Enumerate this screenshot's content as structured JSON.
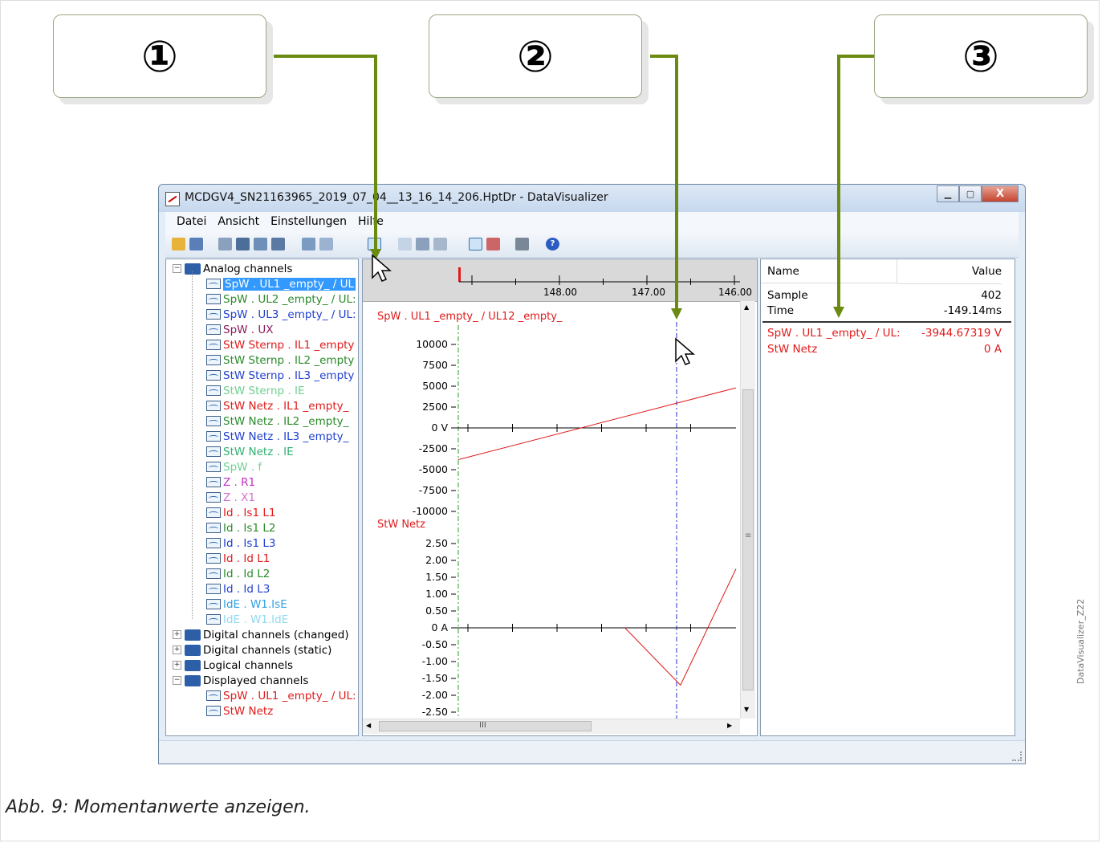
{
  "callouts": [
    {
      "label": "①"
    },
    {
      "label": "②"
    },
    {
      "label": "③"
    }
  ],
  "window": {
    "title": "MCDGV4_SN21163965_2019_07_04__13_16_14_206.HptDr - DataVisualizer",
    "minimize": "▁",
    "maximize": "▢",
    "close": "X"
  },
  "menu": [
    "Datei",
    "Ansicht",
    "Einstellungen",
    "Hilfe"
  ],
  "toolbar_icons": [
    "open-folder-icon",
    "save-icon",
    "settings-icon",
    "cursor-tool-icon",
    "table-icon",
    "window-icon",
    "channel-icon",
    "grid-icon",
    "momentary-values-icon",
    "zoom-1-1-icon",
    "zoom-in-icon",
    "zoom-out-icon",
    "fit-width-icon",
    "cursor-marker-icon",
    "print-icon",
    "help-icon"
  ],
  "tree": {
    "analog_folder": "Analog channels",
    "analog_items": [
      {
        "label": "SpW . UL1 _empty_ / UL",
        "color": "#ffffff",
        "selected": true
      },
      {
        "label": "SpW . UL2 _empty_ / UL:",
        "color": "#2a8a2a"
      },
      {
        "label": "SpW . UL3 _empty_ / UL:",
        "color": "#1f3fcf"
      },
      {
        "label": "SpW . UX",
        "color": "#8a1a5a"
      },
      {
        "label": "StW Sternp . IL1 _empty",
        "color": "#e01a1a"
      },
      {
        "label": "StW Sternp . IL2 _empty",
        "color": "#2a8a2a"
      },
      {
        "label": "StW Sternp . IL3 _empty",
        "color": "#1f3fcf"
      },
      {
        "label": "StW Sternp . IE",
        "color": "#6fd08f"
      },
      {
        "label": "StW Netz . IL1 _empty_",
        "color": "#e01a1a"
      },
      {
        "label": "StW Netz . IL2 _empty_",
        "color": "#2a8a2a"
      },
      {
        "label": "StW Netz . IL3 _empty_",
        "color": "#1f3fcf"
      },
      {
        "label": "StW Netz . IE",
        "color": "#2fb070"
      },
      {
        "label": "SpW . f",
        "color": "#6fd08f"
      },
      {
        "label": "Z . R1",
        "color": "#c030c0"
      },
      {
        "label": "Z . X1",
        "color": "#d070d0"
      },
      {
        "label": "Id . Is1 L1",
        "color": "#e01a1a"
      },
      {
        "label": "Id . Is1 L2",
        "color": "#2a8a2a"
      },
      {
        "label": "Id . Is1 L3",
        "color": "#1f3fcf"
      },
      {
        "label": "Id . Id L1",
        "color": "#e01a1a"
      },
      {
        "label": "Id . Id L2",
        "color": "#2a8a2a"
      },
      {
        "label": "Id . Id L3",
        "color": "#1f3fcf"
      },
      {
        "label": "IdE . W1.IsE",
        "color": "#30a0e0"
      },
      {
        "label": "IdE . W1.IdE",
        "color": "#90d8f0"
      }
    ],
    "folders": [
      "Digital channels (changed)",
      "Digital channels (static)",
      "Logical channels"
    ],
    "displayed_folder": "Displayed channels",
    "displayed_items": [
      {
        "label": "SpW . UL1 _empty_ / UL:",
        "color": "#e01a1a"
      },
      {
        "label": "StW Netz",
        "color": "#e01a1a"
      }
    ]
  },
  "ruler": {
    "ticks": [
      "148.00",
      "147.00",
      "146.00"
    ]
  },
  "chart_data": [
    {
      "type": "line",
      "title": "SpW . UL1 _empty_ / UL12 _empty_",
      "ylabel": "V",
      "ylim": [
        -10000,
        10000
      ],
      "yticks": [
        "10000",
        "7500",
        "5000",
        "2500",
        "0 V",
        "-2500",
        "-5000",
        "-7500",
        "-10000"
      ],
      "series": [
        {
          "color": "#e01a1a",
          "x": [
            0,
            1
          ],
          "y": [
            -3800,
            4800
          ]
        }
      ]
    },
    {
      "type": "line",
      "title": "StW Netz",
      "ylabel": "A",
      "ylim": [
        -2.5,
        2.5
      ],
      "yticks": [
        "2.50",
        "2.00",
        "1.50",
        "1.00",
        "0.50",
        "0 A",
        "-0.50",
        "-1.00",
        "-1.50",
        "-2.00",
        "-2.50"
      ],
      "series": [
        {
          "color": "#e01a1a",
          "x": [
            0.6,
            0.8,
            1.0
          ],
          "y": [
            0,
            -1.7,
            1.75
          ]
        }
      ]
    }
  ],
  "values": {
    "col_name": "Name",
    "col_value": "Value",
    "rows": [
      {
        "name": "Sample",
        "value": "402",
        "color": "#000000"
      },
      {
        "name": "Time",
        "value": "-149.14ms",
        "color": "#000000"
      }
    ],
    "channel_rows": [
      {
        "name": "SpW . UL1 _empty_ / UL:",
        "value": "-3944.67319 V",
        "color": "#e01a1a"
      },
      {
        "name": "StW Netz",
        "value": "0 A",
        "color": "#e01a1a"
      }
    ]
  },
  "caption": "Abb. 9: Momentanwerte anzeigen.",
  "side_label": "DataVisualizer_Z22",
  "hscroll_label": "III",
  "vscroll_label": "≡"
}
